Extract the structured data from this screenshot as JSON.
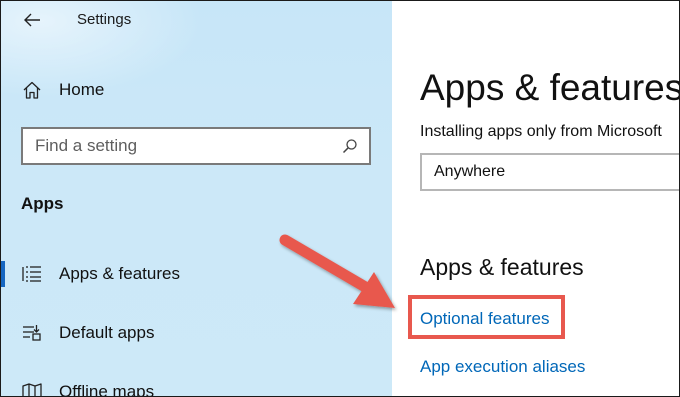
{
  "window": {
    "title": "Settings"
  },
  "sidebar": {
    "home_label": "Home",
    "search_placeholder": "Find a setting",
    "section_heading": "Apps",
    "items": [
      {
        "label": "Apps & features",
        "icon": "list-icon",
        "selected": true
      },
      {
        "label": "Default apps",
        "icon": "default-apps-icon",
        "selected": false
      },
      {
        "label": "Offline maps",
        "icon": "map-icon",
        "selected": false
      }
    ]
  },
  "main": {
    "title": "Apps & features",
    "install_text": "Installing apps only from Microsoft",
    "source_select_value": "Anywhere",
    "sub_heading": "Apps & features",
    "links": {
      "optional_features": "Optional features",
      "app_execution_aliases": "App execution aliases"
    }
  },
  "annotation": {
    "color": "#e8584e"
  },
  "colors": {
    "sidebar_bg": "#cde9f8",
    "link": "#0067b8",
    "accent": "#1565c0"
  }
}
